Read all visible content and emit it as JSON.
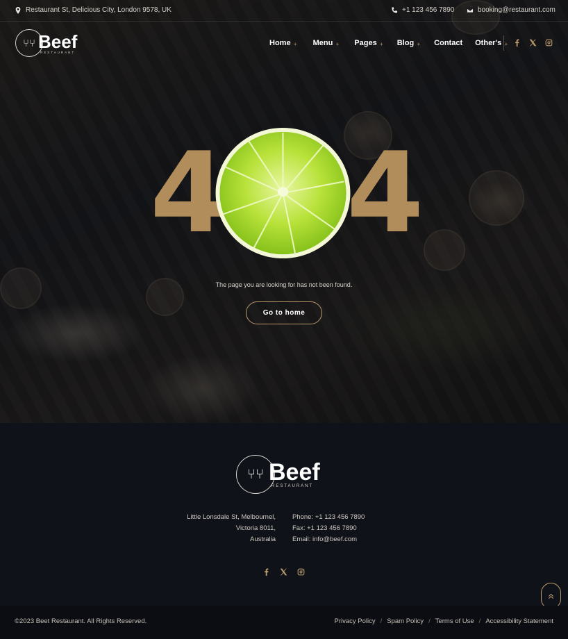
{
  "topbar": {
    "address": "Restaurant St, Delicious City, London 9578, UK",
    "phone": "+1 123 456 7890",
    "email": "booking@restaurant.com",
    "icons": [
      "map-marker-icon",
      "phone-icon",
      "envelope-icon"
    ]
  },
  "brand": {
    "name": "Beef",
    "tagline": "RESTAURANT"
  },
  "nav": {
    "items": [
      {
        "label": "Home",
        "has_submenu": true
      },
      {
        "label": "Menu",
        "has_submenu": true
      },
      {
        "label": "Pages",
        "has_submenu": true
      },
      {
        "label": "Blog",
        "has_submenu": true
      },
      {
        "label": "Contact",
        "has_submenu": false
      },
      {
        "label": "Other's",
        "has_submenu": true
      }
    ],
    "submenu_marker": "+"
  },
  "social": [
    "facebook-icon",
    "x-twitter-icon",
    "instagram-icon"
  ],
  "error": {
    "digit_left": "4",
    "digit_right": "4",
    "message": "The page you are looking for has not been found.",
    "button_label": "Go to home"
  },
  "footer": {
    "address_lines": [
      "Little Lonsdale St, Melbournel,",
      "Victoria 8011,",
      "Australia"
    ],
    "phone": "Phone: +1 123 456 7890",
    "fax": "Fax: +1 123 456 7890",
    "email": "Email: info@beef.com",
    "copyright": "©2023 Beet Restaurant. All Rights Reserved.",
    "legal_links": [
      "Privacy Policy",
      "Spam Policy",
      "Terms of Use",
      "Accessibility Statement"
    ],
    "legal_separator": "/",
    "back_to_top_icon": "double-chevron-up-icon"
  },
  "colors": {
    "accent": "#b99b6b",
    "digit": "#b08d5b",
    "background": "#0f1218",
    "lime": "#9ed832"
  }
}
